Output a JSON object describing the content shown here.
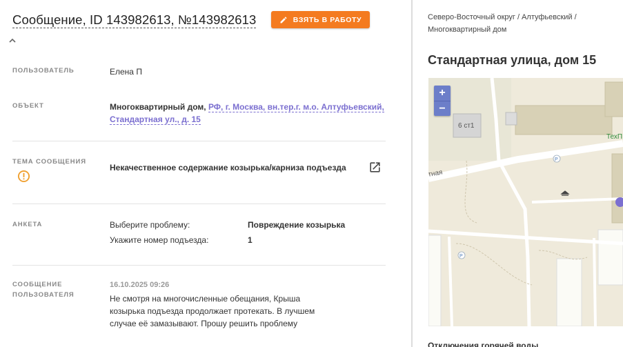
{
  "header": {
    "title": "Сообщение, ID 143982613, №143982613",
    "take_button": "ВЗЯТЬ В РАБОТУ"
  },
  "fields": {
    "user_label": "ПОЛЬЗОВАТЕЛЬ",
    "user_value": "Елена П",
    "object_label": "ОБЪЕКТ",
    "object_type": "Многоквартирный дом,",
    "object_address": "РФ, г. Москва, вн.тер.г. м.о. Алтуфьевский, Стандартная ул., д. 15",
    "topic_label": "ТЕМА СООБЩЕНИЯ",
    "topic_value": "Некачественное содержание козырька/карниза подъезда",
    "survey_label": "АНКЕТА",
    "survey": [
      {
        "question": "Выберите проблему:",
        "answer": "Повреждение козырька"
      },
      {
        "question": "Укажите номер подъезда:",
        "answer": "1"
      }
    ],
    "message_label_1": "СООБЩЕНИЕ",
    "message_label_2": "ПОЛЬЗОВАТЕЛЯ",
    "message_date": "16.10.2025 09:26",
    "message_text": "Не смотря на многочисленные обещания, Крыша козырька подъезда продолжает протекать. В лучшем случае её замазывают. Прошу решить проблему"
  },
  "right": {
    "breadcrumbs": "Северо-Восточный округ / Алтуфьевский / Многоквартирный дом",
    "address_title": "Стандартная улица, дом 15",
    "map": {
      "zoom_in": "+",
      "zoom_out": "−",
      "building_label": "6 ст1",
      "street_label": "тная",
      "poi_label": "ТехП",
      "parking": "P"
    },
    "bottom_partial": "Отключения горячей воды"
  },
  "colors": {
    "accent_orange": "#f47b20",
    "link_purple": "#7b6fd0",
    "zoom_blue": "#6c7ec9",
    "warning": "#f0a030"
  },
  "icons": {
    "take_button_icon": "pencil-icon",
    "collapse_icon": "chevron-up-icon",
    "topic_status_icon": "warning-circle-icon",
    "open_external_icon": "open-external-icon"
  }
}
